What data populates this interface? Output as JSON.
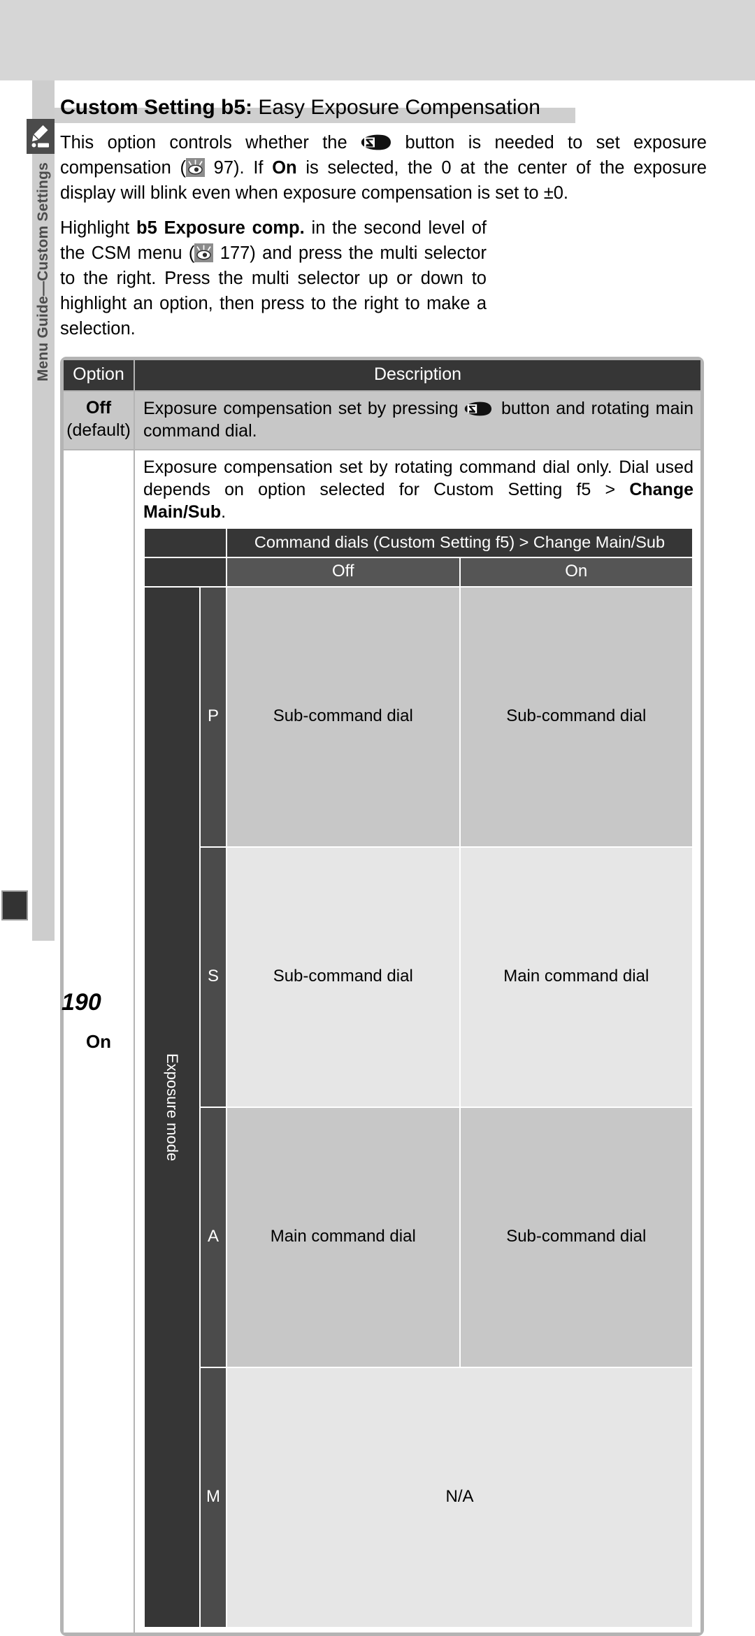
{
  "sidebar": {
    "icon": "pencil-note-icon",
    "label": "Menu Guide—Custom Settings"
  },
  "heading": {
    "bold_part": "Custom Setting b5:",
    "rest": " Easy Exposure Compensation"
  },
  "intro": {
    "part1": "This option controls whether the ",
    "icon1": "exposure-compensation-button-icon",
    "part2": " button is needed to set exposure compensation (",
    "icon2": "see-also-eye-icon",
    "part3": " 97).  If ",
    "bold1": "On",
    "part4": " is selected, the 0 at the center of the exposure display will blink even when exposure compensation is set to ±0."
  },
  "instructions": {
    "part1": "Highlight ",
    "bold1": "b5 Exposure comp.",
    "part2": " in the second level of the CSM menu (",
    "icon1": "see-also-eye-icon",
    "part3": " 177) and press the multi selector to the right.  Press the multi selector up or down to highlight an option, then press to the right to make a selection."
  },
  "table": {
    "headers": {
      "option": "Option",
      "description": "Description"
    },
    "rows": [
      {
        "option_label": "Off",
        "option_sub": "(default)",
        "desc_part1": "Exposure compensation set by pressing ",
        "desc_icon": "exposure-compensation-button-icon",
        "desc_part2": " button and rotating main command dial."
      },
      {
        "option_label": "On",
        "desc_part1": "Exposure compensation set by rotating command dial only.  Dial used depends on option selected for Custom Setting f5 > ",
        "desc_bold": "Change Main/Sub",
        "desc_part2": "."
      }
    ],
    "nested": {
      "title": "Command dials (Custom Setting f5) > Change Main/Sub",
      "column_headers": [
        "Off",
        "On"
      ],
      "row_group_label": "Exposure mode",
      "rows": [
        {
          "mode": "P",
          "off": "Sub-command dial",
          "on": "Sub-command dial"
        },
        {
          "mode": "S",
          "off": "Sub-command dial",
          "on": "Main command dial"
        },
        {
          "mode": "A",
          "off": "Main command dial",
          "on": "Sub-command dial"
        },
        {
          "mode": "M",
          "span": "N/A"
        }
      ]
    }
  },
  "footer": {
    "page_number": "190"
  },
  "colors": {
    "band": "#d6d6d6",
    "side_tab": "#cdcdcd",
    "header_dark": "#363636",
    "header_mid": "#555555",
    "cell_a": "#c7c7c7",
    "cell_b": "#e6e6e6",
    "table_border": "#b4b4b4"
  }
}
